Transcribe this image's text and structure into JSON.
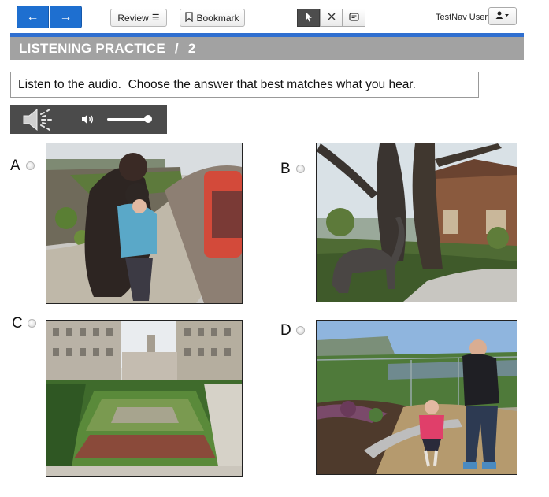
{
  "toolbar": {
    "back_icon": "arrow-left-icon",
    "next_icon": "arrow-right-icon",
    "back_glyph": "←",
    "next_glyph": "→",
    "review_label": "Review",
    "review_glyph": "☰",
    "bookmark_label": "Bookmark",
    "bookmark_glyph": "⚐",
    "tools": [
      {
        "name": "pointer-tool",
        "glyph": "➤",
        "active": true
      },
      {
        "name": "answer-eliminator-tool",
        "glyph": "✕",
        "active": false
      },
      {
        "name": "notepad-tool",
        "glyph": "▤",
        "active": false
      }
    ],
    "user_name": "TestNav User",
    "user_glyph": "♟ ▾"
  },
  "section": {
    "title": "LISTENING PRACTICE",
    "separator": "/",
    "number": "2"
  },
  "question": {
    "prompt": "Listen to the audio.  Choose the answer that best matches what you hear."
  },
  "audio": {
    "play_icon": "speaker-play-icon",
    "volume_icon": "volume-icon",
    "volume_level": 0.92
  },
  "options": [
    {
      "letter": "A",
      "image": "woman-with-child-on-bench-photo"
    },
    {
      "letter": "B",
      "image": "elephant-statue-under-tree-photo"
    },
    {
      "letter": "C",
      "image": "formal-garden-photo"
    },
    {
      "letter": "D",
      "image": "man-and-girl-in-garden-photo"
    }
  ],
  "colors": {
    "nav_blue": "#1e6fd0",
    "rule_blue": "#2f6fd0",
    "title_gray": "#a2a2a2",
    "audio_bg": "#4b4b4b"
  }
}
